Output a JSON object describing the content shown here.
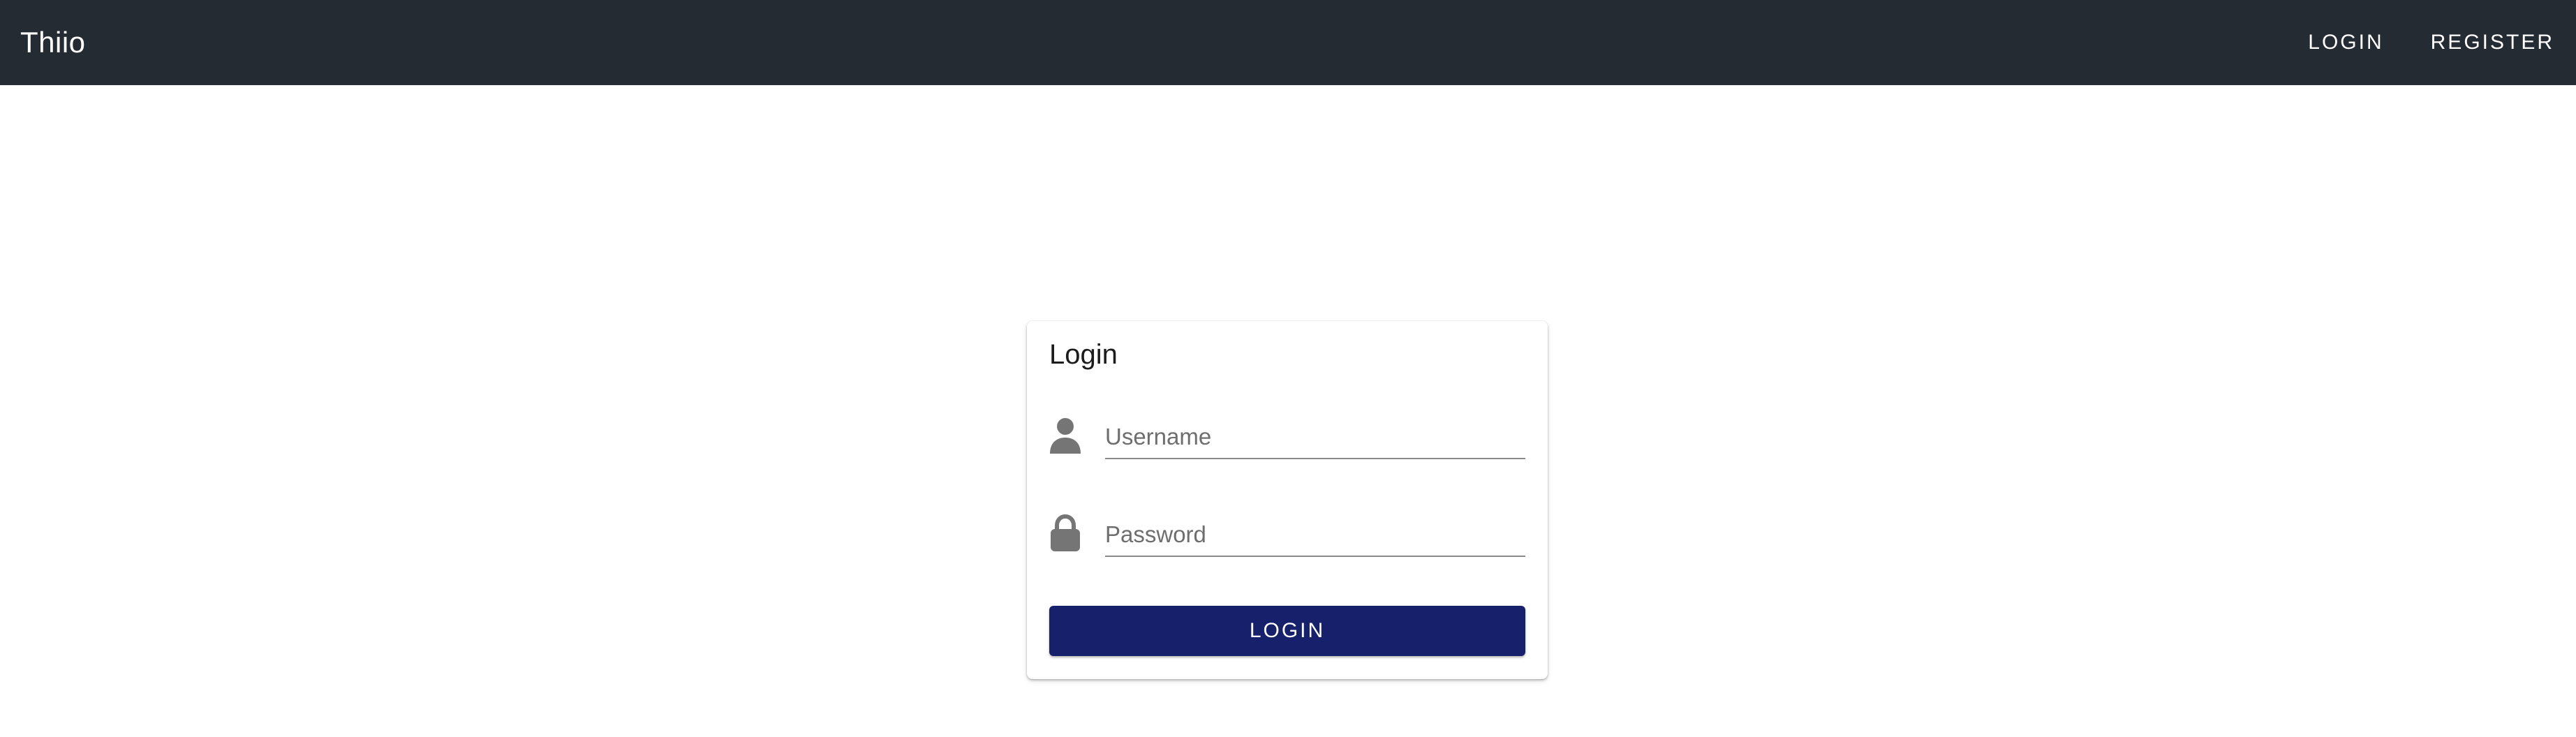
{
  "appbar": {
    "brand": "Thiio",
    "nav": {
      "login_label": "LOGIN",
      "register_label": "REGISTER"
    }
  },
  "login_card": {
    "title": "Login",
    "username": {
      "icon": "person-icon",
      "placeholder": "Username",
      "value": ""
    },
    "password": {
      "icon": "lock-icon",
      "placeholder": "Password",
      "value": ""
    },
    "submit_label": "LOGIN"
  },
  "colors": {
    "appbar_background": "#252b33",
    "button_background": "#17206b",
    "icon_color": "#757575"
  }
}
